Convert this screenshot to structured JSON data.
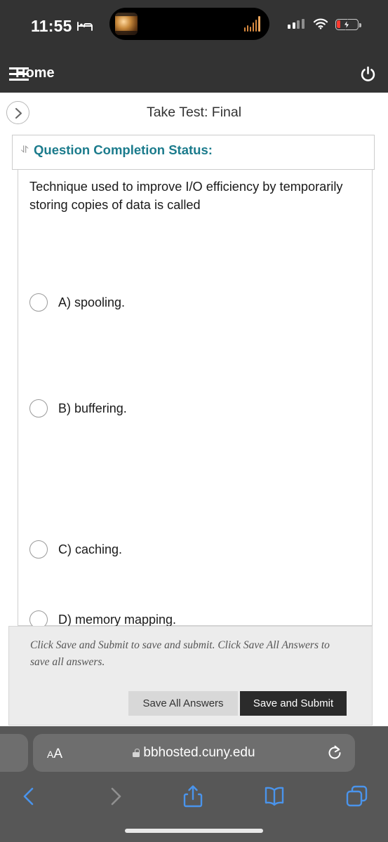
{
  "status_bar": {
    "time": "11:55",
    "focus_icon": "bed-icon",
    "signal_icon": "cellular-signal-icon",
    "wifi_icon": "wifi-icon",
    "battery_icon": "battery-charging-low-icon",
    "dynamic_island": {
      "thumbnail": "media-thumbnail",
      "waveform": "audio-waveform-icon"
    }
  },
  "app_nav": {
    "menu_icon": "hamburger-menu-icon",
    "home_label": "Home",
    "power_icon": "power-logout-icon"
  },
  "title_bar": {
    "back_icon": "chevron-right-circle-icon",
    "title": "Take Test: Final"
  },
  "question_completion_status": {
    "expander_icon": "chevron-double-down-icon",
    "label": "Question Completion Status:"
  },
  "question": {
    "text": "Technique used to improve I/O efficiency by temporarily storing copies of data is called",
    "options": [
      {
        "label": "A) spooling.",
        "selected": false
      },
      {
        "label": "B) buffering.",
        "selected": false
      },
      {
        "label": "C) caching.",
        "selected": false
      },
      {
        "label": "D) memory mapping.",
        "selected": false
      }
    ]
  },
  "footer": {
    "note": "Click Save and Submit to save and submit. Click Save All Answers to save all answers.",
    "save_all_label": "Save All Answers",
    "save_submit_label": "Save and Submit"
  },
  "browser": {
    "text_size_small": "A",
    "text_size_large": "A",
    "lock_icon": "lock-icon",
    "url": "bbhosted.cuny.edu",
    "reload_icon": "reload-icon",
    "back_icon": "chevron-left-icon",
    "forward_icon": "chevron-right-icon",
    "share_icon": "share-icon",
    "bookmarks_icon": "book-icon",
    "tabs_icon": "tabs-icon"
  },
  "colors": {
    "nav_dark": "#333333",
    "accent_teal": "#1b7b8c",
    "safari_blue": "#4a94ec",
    "submit_dark": "#2b2b2b",
    "battery_red": "#ff3b30"
  }
}
